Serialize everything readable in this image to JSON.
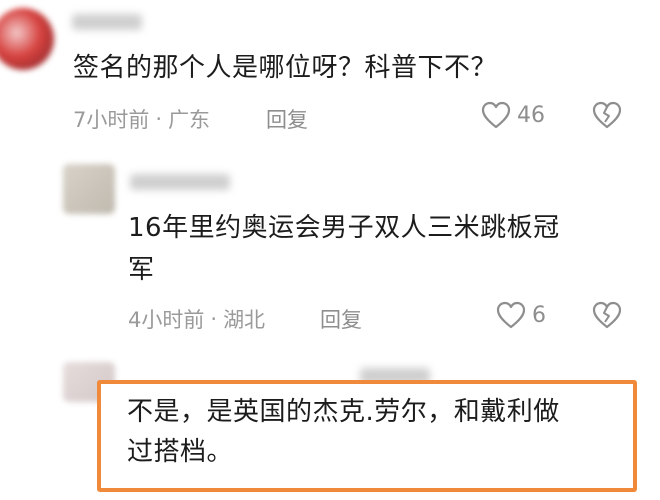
{
  "comments": [
    {
      "text": "签名的那个人是哪位呀？科普下不？",
      "time": "7小时前",
      "location": "广东",
      "reply_label": "回复",
      "likes": "46",
      "like_icon": "heart-outline-icon",
      "dislike_icon": "broken-heart-icon"
    },
    {
      "text_line1": "16年里约奥运会男子双人三米跳板冠",
      "text_line2": "军",
      "time": "4小时前",
      "location": "湖北",
      "reply_label": "回复",
      "likes": "6",
      "like_icon": "heart-outline-icon",
      "dislike_icon": "broken-heart-icon"
    },
    {
      "text_line1": "不是，是英国的杰克.劳尔，和戴利做",
      "text_line2": "过搭档。"
    }
  ],
  "meta_separator": "·",
  "colors": {
    "highlight_border": "#f0893a",
    "meta_text": "#9a9a9a",
    "icon_stroke": "#8e8e8e"
  }
}
